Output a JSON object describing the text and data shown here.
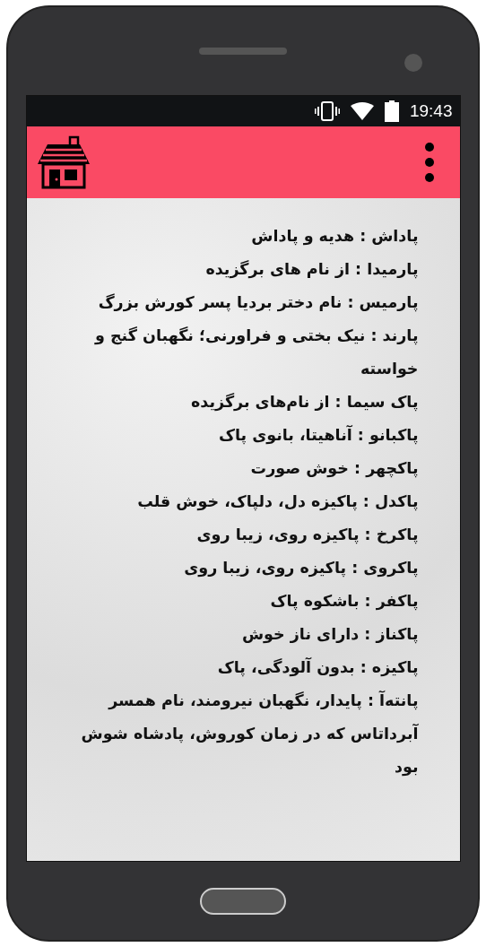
{
  "status_bar": {
    "time": "19:43"
  },
  "entries": [
    "پاداش : هدیه و پاداش",
    "پارمیدا : از نام های برگزیده",
    "پارمیس : نام دختر بردیا پسر کورش بزرگ",
    "پارند : نیک بختی و فراورنی؛ نگهبان گنج و خواسته",
    "پاک سیما : از نام‌های برگزیده",
    "پاکبانو : آناهیتا، بانوی پاک",
    "پاکچهر : خوش صورت",
    "پاکدل : پاکیزه دل، دلپاک، خوش قلب",
    "پاکرخ : پاکیزه روی، زیبا روی",
    "پاکروی : پاکیزه روی، زیبا روی",
    "پاکفر : باشکوه پاک",
    "پاکناز : دارای ناز خوش",
    "پاکیزه : بدون آلودگی، پاک",
    "پانته‌آ : پایدار، نگهبان نیرومند، نام همسر آبرداتاس که در زمان کوروش، پادشاه شوش بود"
  ]
}
